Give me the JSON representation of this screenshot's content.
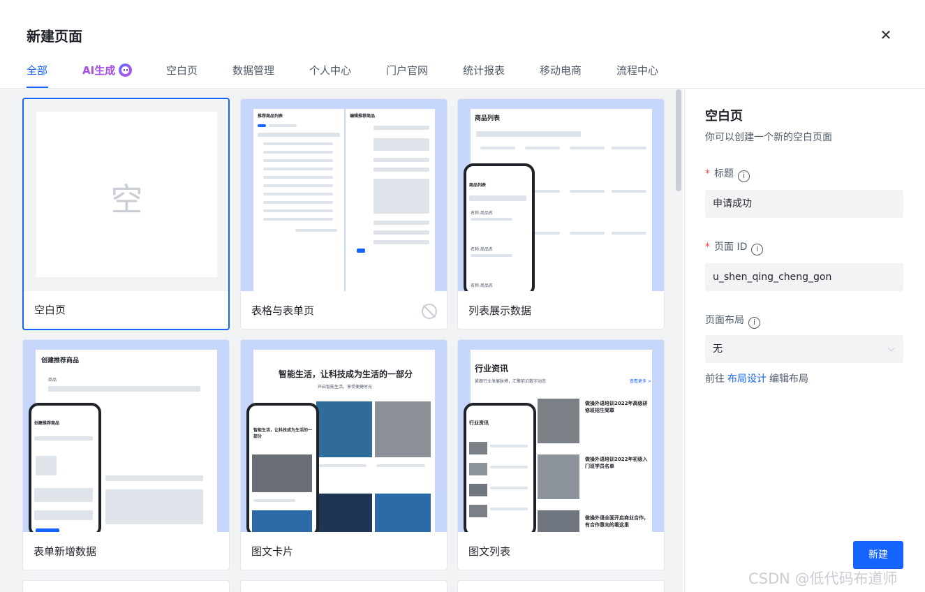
{
  "dialog": {
    "title": "新建页面",
    "close_icon": "close-icon"
  },
  "tabs": [
    {
      "label": "全部",
      "active": true
    },
    {
      "label": "AI生成",
      "active": false
    },
    {
      "label": "空白页",
      "active": false
    },
    {
      "label": "数据管理",
      "active": false
    },
    {
      "label": "个人中心",
      "active": false
    },
    {
      "label": "门户官网",
      "active": false
    },
    {
      "label": "统计报表",
      "active": false
    },
    {
      "label": "移动电商",
      "active": false
    },
    {
      "label": "流程中心",
      "active": false
    }
  ],
  "cards": [
    {
      "label": "空白页",
      "blank_char": "空",
      "selected": true
    },
    {
      "label": "表格与表单页"
    },
    {
      "label": "列表展示数据"
    },
    {
      "label": "表单新增数据"
    },
    {
      "label": "图文卡片"
    },
    {
      "label": "图文列表"
    }
  ],
  "thumbs": {
    "table_form": {
      "left_title": "推荐商品列表",
      "right_title": "编辑推荐商品"
    },
    "list": {
      "title": "商品列表",
      "phone_title": "商品列表",
      "item": "名称:商品名"
    },
    "form_add": {
      "title": "创建推荐商品",
      "field": "商品",
      "phone_title": "创建推荐商品"
    },
    "card": {
      "headline": "智能生活，让科技成为生活的一部分",
      "sub": "开启智能生活，享受便捷时光",
      "phone_headline": "智能生活，让科技成为生活的一部分"
    },
    "news": {
      "title": "行业资讯",
      "desc": "紧跟行业发展脉搏，汇聚前沿数字动态",
      "more": "查看更多 >",
      "items": [
        "做操外语培训2022年高级研修班招生简章",
        "做操外语培训2022年初级入门班学员名单",
        "做操外语全面开启商业合作，有合作意向的看这里"
      ],
      "phone_title": "行业资讯"
    }
  },
  "panel": {
    "title": "空白页",
    "description": "你可以创建一个新的空白页面",
    "title_label": "标题",
    "title_value": "申请成功",
    "id_label": "页面 ID",
    "id_value": "u_shen_qing_cheng_gon",
    "layout_label": "页面布局",
    "layout_value": "无",
    "goto_prefix": "前往",
    "goto_link": "布局设计",
    "goto_suffix": "编辑布局",
    "create_button": "新建"
  },
  "watermark": "CSDN @低代码布道师",
  "colors": {
    "accent": "#1664ff",
    "ai": "#a64ee8",
    "required": "#f53f3f",
    "thumb_bg": "#c7d7fc"
  }
}
